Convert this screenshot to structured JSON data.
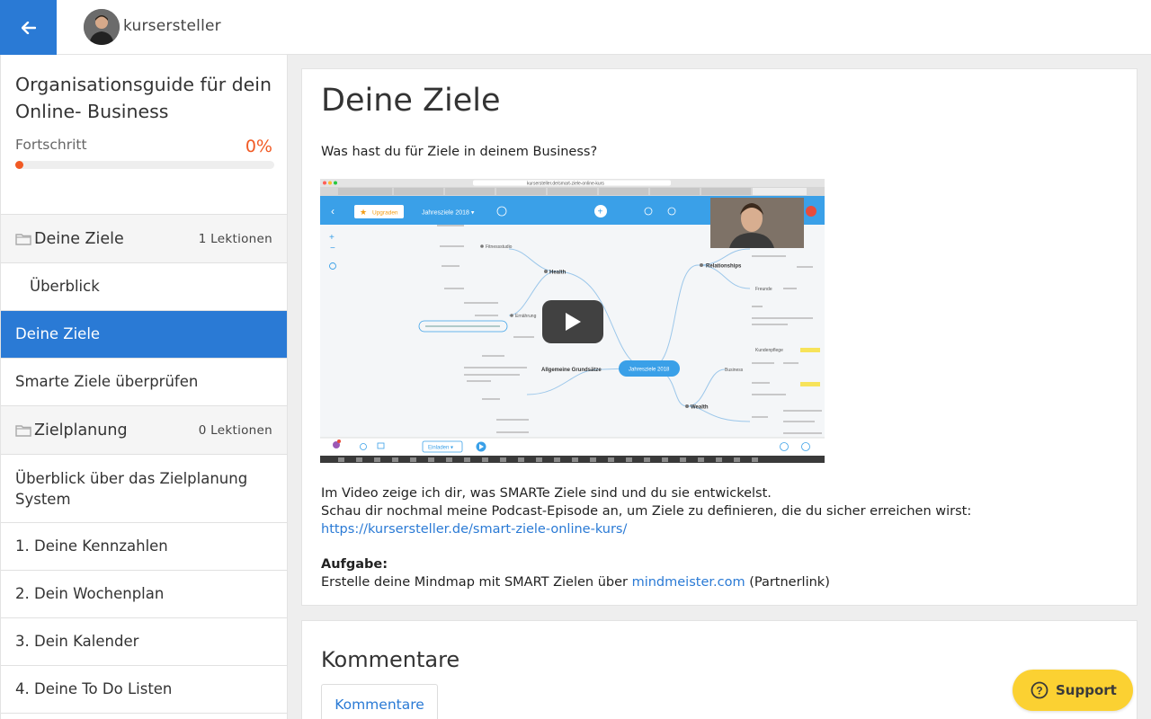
{
  "header": {
    "brand": "kursersteller"
  },
  "course": {
    "title": "Organisationsguide für dein Online- Business",
    "progress_label": "Fortschritt",
    "progress_pct": "0%",
    "progress_value": 0
  },
  "sidebar": {
    "sections": [
      {
        "name": "Deine Ziele",
        "count": "1 Lektionen"
      },
      {
        "name": "Zielplanung",
        "count": "0 Lektionen"
      }
    ],
    "lessons": [
      {
        "label": "Überblick"
      },
      {
        "label": "Deine Ziele"
      },
      {
        "label": "Smarte Ziele überprüfen"
      },
      {
        "label": "Überblick über das Zielplanung System"
      },
      {
        "label": "1. Deine Kennzahlen"
      },
      {
        "label": "2. Dein Wochenplan"
      },
      {
        "label": "3. Dein Kalender"
      },
      {
        "label": "4. Deine To Do Listen"
      }
    ]
  },
  "main": {
    "title": "Deine Ziele",
    "question": "Was hast du für Ziele in deinem Business?",
    "video": {
      "browser_url": "kursersteller.de/smart-ziele-online-kurs",
      "upgrade": "Upgraden",
      "map_title": "Jahresziele 2018 ▾",
      "center_node": "Jahresziele 2018",
      "nodes": [
        "Health",
        "Relationships",
        "Allgemeine Grundsätze",
        "Wealth",
        "Business",
        "Fitnessstudio",
        "Ernährung",
        "Freunde",
        "Kundenpflege"
      ],
      "invite": "Einladen ▾"
    },
    "desc_line1": "Im Video zeige ich dir, was SMARTe Ziele sind und du sie entwickelst.",
    "desc_line2": "Schau dir nochmal meine Podcast-Episode an, um Ziele zu definieren, die du sicher erreichen wirst:",
    "link": "https://kursersteller.de/smart-ziele-online-kurs/",
    "task_heading": "Aufgabe:",
    "task_text": "Erstelle deine Mindmap mit SMART Zielen über",
    "task_link": "mindmeister.com",
    "task_suffix": "(Partnerlink)"
  },
  "comments": {
    "title": "Kommentare",
    "tab": "Kommentare"
  },
  "support": {
    "label": "Support"
  },
  "colors": {
    "primary": "#2a7ad5",
    "accent": "#f15a24",
    "support": "#fbd132"
  }
}
